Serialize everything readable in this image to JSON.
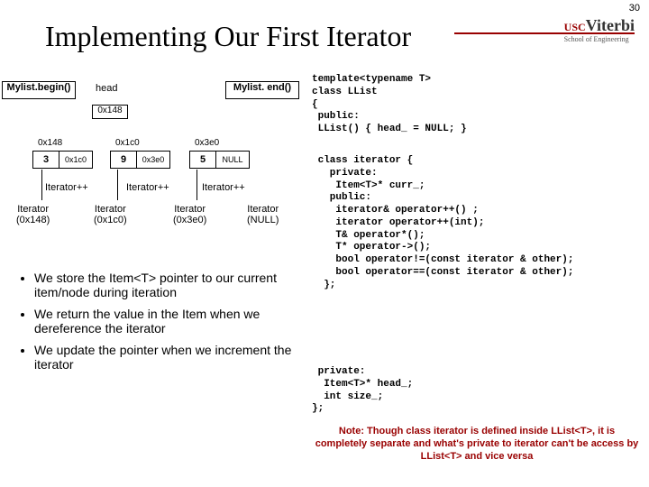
{
  "pagenum": "30",
  "logo": {
    "usc": "USC",
    "viterbi": "Viterbi",
    "school": "School of Engineering"
  },
  "title": "Implementing Our First Iterator",
  "diagram": {
    "begin": "Mylist.begin()",
    "end": "Mylist. end()",
    "head_label": "head",
    "head_addr": "0x148",
    "addrs": {
      "n1": "0x148",
      "n2": "0x1c0",
      "n3": "0x3e0"
    },
    "nodes": {
      "n1": {
        "val": "3",
        "next": "0x1c0"
      },
      "n2": {
        "val": "9",
        "next": "0x3e0"
      },
      "n3": {
        "val": "5",
        "next": "NULL"
      }
    },
    "itpp": "Iterator++",
    "iters": {
      "i1a": "Iterator",
      "i1b": "(0x148)",
      "i2a": "Iterator",
      "i2b": "(0x1c0)",
      "i3a": "Iterator",
      "i3b": "(0x3e0)",
      "i4a": "Iterator",
      "i4b": "(NULL)"
    }
  },
  "bullets": {
    "b1": "We store the Item<T> pointer to our current item/node during iteration",
    "b2": "We return the value in the Item when we dereference the iterator",
    "b3": "We update the pointer when we increment the iterator"
  },
  "code1": "template<typename T>\nclass LList\n{\n public:\n LList() { head_ = NULL; }",
  "code2": " class iterator {\n   private:\n    Item<T>* curr_;\n   public:\n    iterator& operator++() ;\n    iterator operator++(int);\n    T& operator*();\n    T* operator->();\n    bool operator!=(const iterator & other);\n    bool operator==(const iterator & other);\n  };",
  "code3": " private:\n  Item<T>* head_;\n  int size_;\n};",
  "note": "Note: Though class iterator is defined inside LList<T>, it is completely separate and what's private to iterator can't be access by LList<T> and vice versa"
}
